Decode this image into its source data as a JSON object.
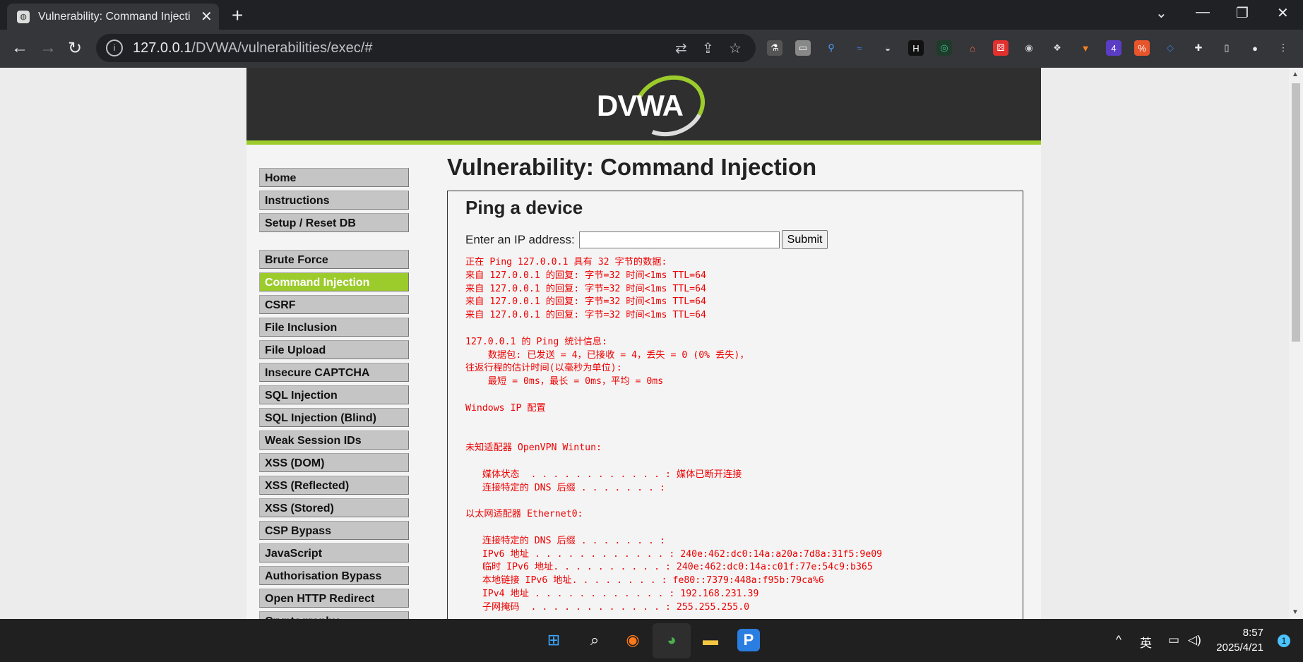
{
  "browser": {
    "tab_title": "Vulnerability: Command Injecti",
    "url_host": "127.0.0.1",
    "url_path": "/DVWA/vulnerabilities/exec/#"
  },
  "dvwa": {
    "logo": "DVWA",
    "menu_group1": [
      "Home",
      "Instructions",
      "Setup / Reset DB"
    ],
    "menu_group2": [
      "Brute Force",
      "Command Injection",
      "CSRF",
      "File Inclusion",
      "File Upload",
      "Insecure CAPTCHA",
      "SQL Injection",
      "SQL Injection (Blind)",
      "Weak Session IDs",
      "XSS (DOM)",
      "XSS (Reflected)",
      "XSS (Stored)",
      "CSP Bypass",
      "JavaScript",
      "Authorisation Bypass",
      "Open HTTP Redirect",
      "Cryptography"
    ],
    "active_item": "Command Injection",
    "page_title": "Vulnerability: Command Injection",
    "box_title": "Ping a device",
    "ip_label": "Enter an IP address:",
    "ip_value": "",
    "submit_label": "Submit",
    "output": "正在 Ping 127.0.0.1 具有 32 字节的数据:\n来自 127.0.0.1 的回复: 字节=32 时间<1ms TTL=64\n来自 127.0.0.1 的回复: 字节=32 时间<1ms TTL=64\n来自 127.0.0.1 的回复: 字节=32 时间<1ms TTL=64\n来自 127.0.0.1 的回复: 字节=32 时间<1ms TTL=64\n\n127.0.0.1 的 Ping 统计信息:\n    数据包: 已发送 = 4，已接收 = 4，丢失 = 0 (0% 丢失)，\n往返行程的估计时间(以毫秒为单位):\n    最短 = 0ms，最长 = 0ms，平均 = 0ms\n\nWindows IP 配置\n\n\n未知适配器 OpenVPN Wintun:\n\n   媒体状态  . . . . . . . . . . . . : 媒体已断开连接\n   连接特定的 DNS 后缀 . . . . . . . :\n\n以太网适配器 Ethernet0:\n\n   连接特定的 DNS 后缀 . . . . . . . :\n   IPv6 地址 . . . . . . . . . . . . : 240e:462:dc0:14a:a20a:7d8a:31f5:9e09\n   临时 IPv6 地址. . . . . . . . . . : 240e:462:dc0:14a:c01f:77e:54c9:b365\n   本地链接 IPv6 地址. . . . . . . . : fe80::7379:448a:f95b:79ca%6\n   IPv4 地址 . . . . . . . . . . . . : 192.168.231.39\n   子网掩码  . . . . . . . . . . . . : 255.255.255.0"
  },
  "taskbar": {
    "ime": "英",
    "time": "8:57",
    "date": "2025/4/21",
    "notifications": "1"
  },
  "colors": {
    "accent": "#9ccb2c",
    "output": "#ee0000",
    "header": "#2f2f2f"
  }
}
